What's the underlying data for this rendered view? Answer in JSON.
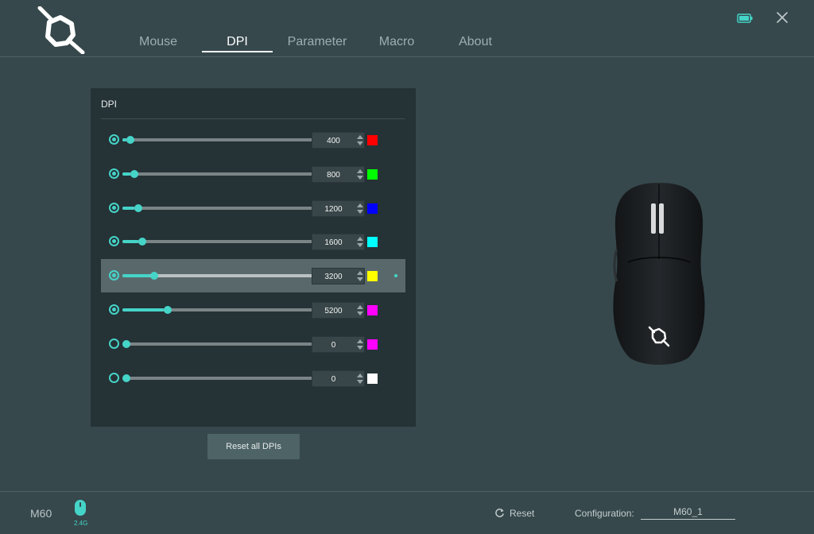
{
  "nav": {
    "tabs": [
      {
        "label": "Mouse"
      },
      {
        "label": "DPI"
      },
      {
        "label": "Parameter"
      },
      {
        "label": "Macro"
      },
      {
        "label": "About"
      }
    ],
    "active_tab": "DPI"
  },
  "icons": {
    "logo": "brand-logo-icon",
    "battery": "battery-icon",
    "close": "close-icon",
    "dongle": "mouse-dongle-icon",
    "reset": "refresh-icon"
  },
  "accent_color": "#45d4c8",
  "panel": {
    "title": "DPI",
    "levels": [
      {
        "enabled": true,
        "value": "400",
        "slider_fraction": 0.02,
        "color": "#ff0000",
        "selected": false
      },
      {
        "enabled": true,
        "value": "800",
        "slider_fraction": 0.04,
        "color": "#00ff00",
        "selected": false
      },
      {
        "enabled": true,
        "value": "1200",
        "slider_fraction": 0.06,
        "color": "#0000ff",
        "selected": false
      },
      {
        "enabled": true,
        "value": "1600",
        "slider_fraction": 0.08,
        "color": "#00ffff",
        "selected": false
      },
      {
        "enabled": true,
        "value": "3200",
        "slider_fraction": 0.14,
        "color": "#ffff00",
        "selected": true
      },
      {
        "enabled": true,
        "value": "5200",
        "slider_fraction": 0.21,
        "color": "#ff00ff",
        "selected": false
      },
      {
        "enabled": false,
        "value": "0",
        "slider_fraction": 0.0,
        "color": "#ff00ff",
        "selected": false
      },
      {
        "enabled": false,
        "value": "0",
        "slider_fraction": 0.0,
        "color": "#ffffff",
        "selected": false
      }
    ]
  },
  "reset_all_label": "Reset all DPIs",
  "footer": {
    "device_name": "M60",
    "connection_label": "2.4G",
    "reset_label": "Reset",
    "config_label": "Configuration:",
    "config_value": "M60_1"
  }
}
